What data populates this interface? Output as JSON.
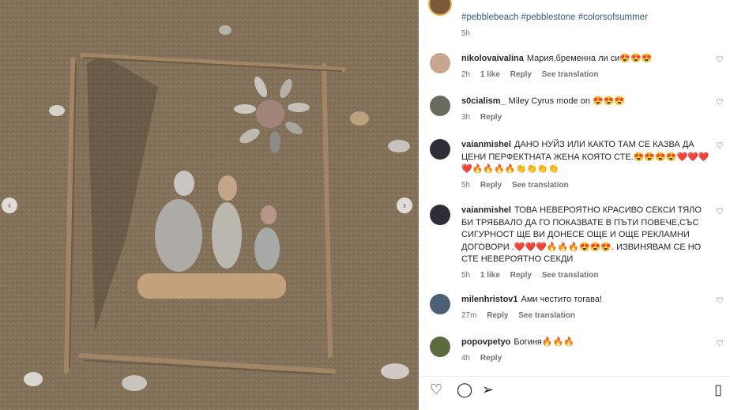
{
  "post": {
    "hashtags": "#pebblebeach #pebblestone #colorsofsummer",
    "time": "5h"
  },
  "comments": [
    {
      "user": "nikolovaivalina",
      "text": "Мария,бременна ли си😍😍😍",
      "time": "2h",
      "likes": "1 like",
      "reply": "Reply",
      "translate": "See translation"
    },
    {
      "user": "s0cialism_",
      "text": "Miley Cyrus mode on 😍😍😍",
      "time": "3h",
      "likes": "",
      "reply": "Reply",
      "translate": ""
    },
    {
      "user": "vaianmishel",
      "text": "ДАНО НУЙЗ ИЛИ КАКТО ТАМ СЕ КАЗВА ДА ЦЕНИ ПЕРФЕКТНАТА ЖЕНА КОЯТО СТЕ.😍😍😍😍❤️❤️❤️❤️🔥🔥🔥🔥👏👏👏👏",
      "time": "5h",
      "likes": "",
      "reply": "Reply",
      "translate": "See translation"
    },
    {
      "user": "vaianmishel",
      "text": "ТОВА НЕВЕРОЯТНО КРАСИВО СЕКСИ ТЯЛО БИ ТРЯБВАЛО ДА ГО ПОКАЗВАТЕ В ПЪТИ ПОВЕЧЕ,СЪС СИГУРНОСТ ЩЕ ВИ ДОНЕСЕ ОЩЕ И ОЩЕ РЕКЛАМНИ ДОГОВОРИ .❤️❤️❤️🔥🔥🔥😍😍😍. ИЗВИНЯВАМ СЕ НО СТЕ НЕВЕРОЯТНО СЕКДИ",
      "time": "5h",
      "likes": "1 like",
      "reply": "Reply",
      "translate": "See translation"
    },
    {
      "user": "milenhristov1",
      "text": "Ами честито тогава!",
      "time": "27m",
      "likes": "",
      "reply": "Reply",
      "translate": "See translation"
    },
    {
      "user": "popovpetyo",
      "text": "Богиня🔥🔥🔥",
      "time": "4h",
      "likes": "",
      "reply": "Reply",
      "translate": ""
    }
  ],
  "actions": {
    "like_icon": "♡",
    "comment_icon": "◯",
    "share_icon": "➢",
    "save_icon": "▯"
  },
  "nav": {
    "prev": "‹",
    "next": "›"
  },
  "comment_like_icon": "♡",
  "colors": {
    "link": "#375a7f",
    "meta": "#737373",
    "text": "#262626"
  }
}
